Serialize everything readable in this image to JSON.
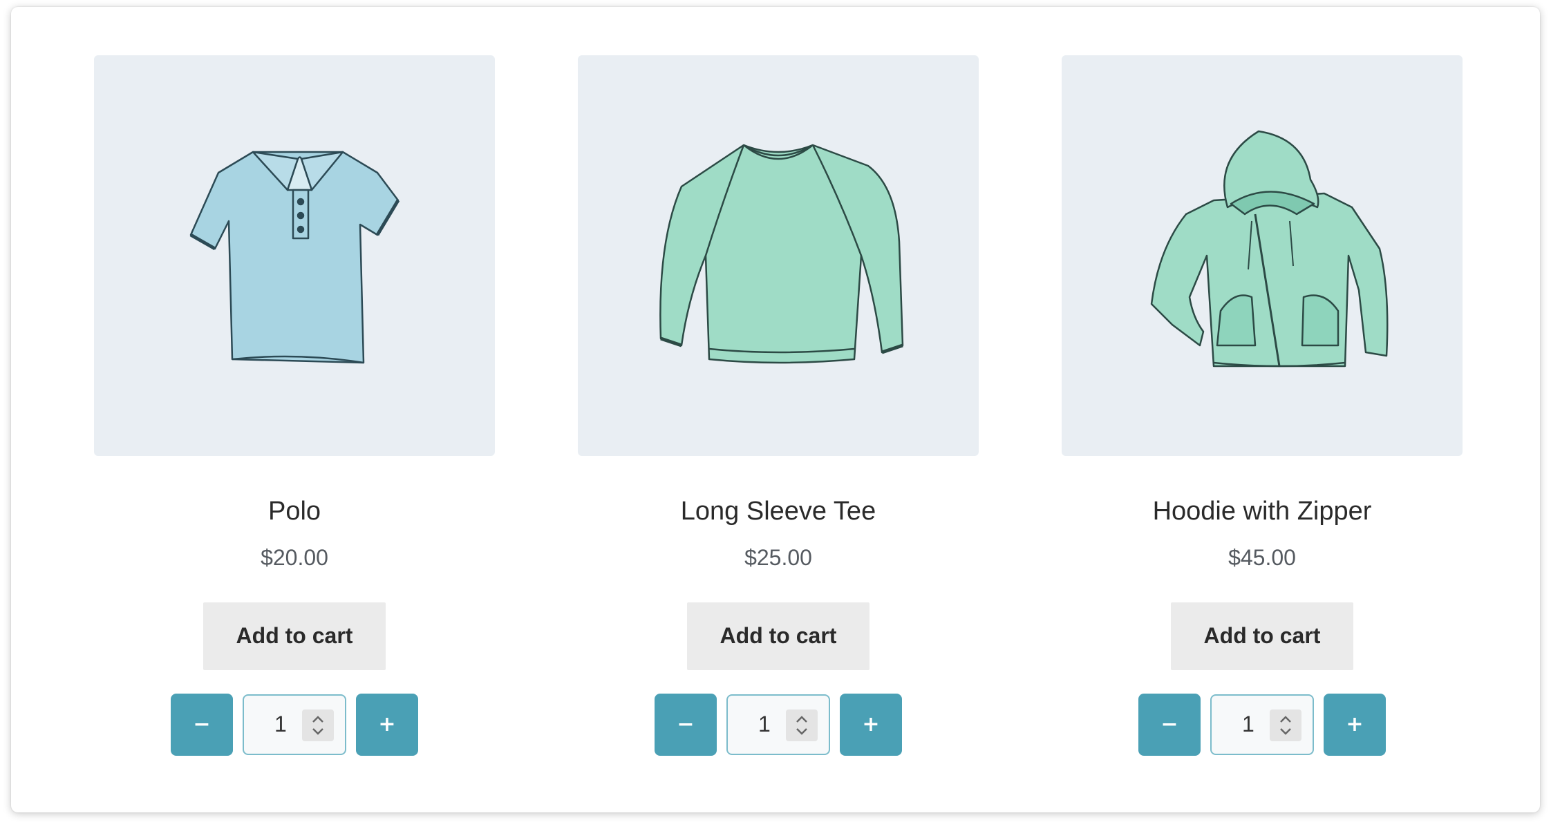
{
  "products": [
    {
      "name": "Polo",
      "price": "$20.00",
      "add_to_cart_label": "Add to cart",
      "quantity": "1",
      "decrement_label": "−",
      "increment_label": "+",
      "image_icon": "polo-shirt-icon",
      "garment_color": "#a8d4e2"
    },
    {
      "name": "Long Sleeve Tee",
      "price": "$25.00",
      "add_to_cart_label": "Add to cart",
      "quantity": "1",
      "decrement_label": "−",
      "increment_label": "+",
      "image_icon": "long-sleeve-tee-icon",
      "garment_color": "#9fdcc6"
    },
    {
      "name": "Hoodie with Zipper",
      "price": "$45.00",
      "add_to_cart_label": "Add to cart",
      "quantity": "1",
      "decrement_label": "−",
      "increment_label": "+",
      "image_icon": "hoodie-icon",
      "garment_color": "#9fdcc6"
    }
  ],
  "colors": {
    "accent": "#4aa0b5",
    "image_background": "#e9eef3",
    "button_background": "#ebebeb"
  }
}
